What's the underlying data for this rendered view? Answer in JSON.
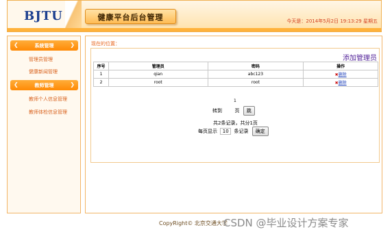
{
  "header": {
    "logo": "BJTU",
    "app_title": "健康平台后台管理",
    "date_text": "今天是：2014年5月2日 19:13:29 星期五"
  },
  "sidebar": {
    "sections": [
      {
        "label": "系统管理",
        "items": [
          "管理员管理",
          "健康新闻管理"
        ]
      },
      {
        "label": "教师管理",
        "items": [
          "教师个人信息管理",
          "教师体检信息管理"
        ]
      }
    ]
  },
  "main": {
    "breadcrumb": "现在的位置：",
    "add_link": "添加管理员",
    "table": {
      "headers": [
        "序号",
        "管理员",
        "密码",
        "操作"
      ],
      "rows": [
        {
          "index": "1",
          "admin": "qian",
          "password": "abc123",
          "action": "删除"
        },
        {
          "index": "2",
          "admin": "root",
          "password": "root",
          "action": "删除"
        }
      ]
    },
    "pagination": {
      "current_page": "1",
      "jump_label": "转到",
      "page_unit": "页",
      "jump_button": "跳",
      "summary": "共2条记录，共分1页",
      "per_page_label": "每页显示",
      "per_page_value": "10",
      "per_page_unit": "条记录",
      "confirm_button": "确定"
    }
  },
  "footer": {
    "copyright": "CopyRight© 北京交通大学"
  },
  "watermark": "CSDN @毕业设计方案专家",
  "colors": {
    "accent": "#ff8a05",
    "nav_text": "#d9621e",
    "add_link": "#4f1f97"
  }
}
